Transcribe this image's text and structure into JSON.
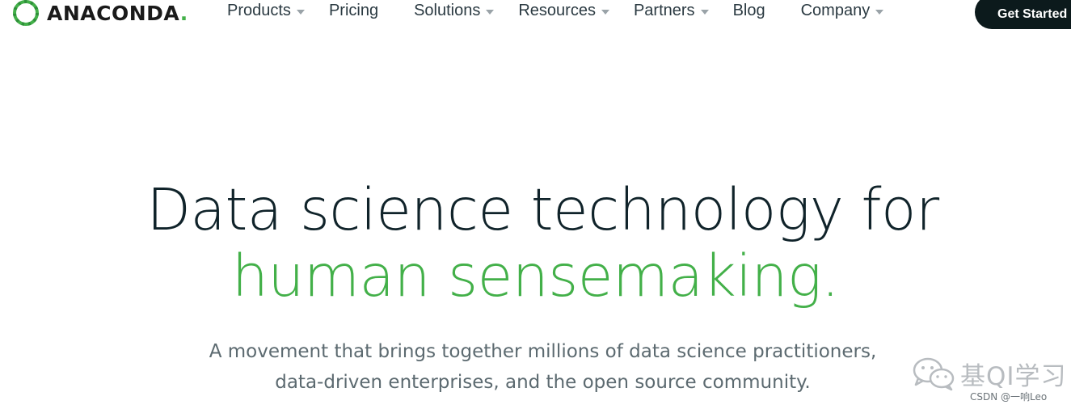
{
  "brand": {
    "name": "ANACONDA",
    "suffix": ".",
    "accent_color": "#43b049",
    "dark_color": "#0c1a1c"
  },
  "nav": {
    "items": [
      {
        "label": "Products",
        "has_dropdown": true
      },
      {
        "label": "Pricing",
        "has_dropdown": false
      },
      {
        "label": "Solutions",
        "has_dropdown": true
      },
      {
        "label": "Resources",
        "has_dropdown": true
      },
      {
        "label": "Partners",
        "has_dropdown": true
      },
      {
        "label": "Blog",
        "has_dropdown": false
      },
      {
        "label": "Company",
        "has_dropdown": true
      }
    ],
    "cta_label": "Get Started"
  },
  "hero": {
    "headline_line1": "Data science technology for",
    "headline_line2": "human sensemaking.",
    "subtext_line1": "A movement that brings together millions of data science practitioners,",
    "subtext_line2": "data-driven enterprises, and the open source community."
  },
  "watermark": {
    "title": "基QI学习",
    "credit": "CSDN @一响Leo",
    "icon": "wechat-icon"
  }
}
